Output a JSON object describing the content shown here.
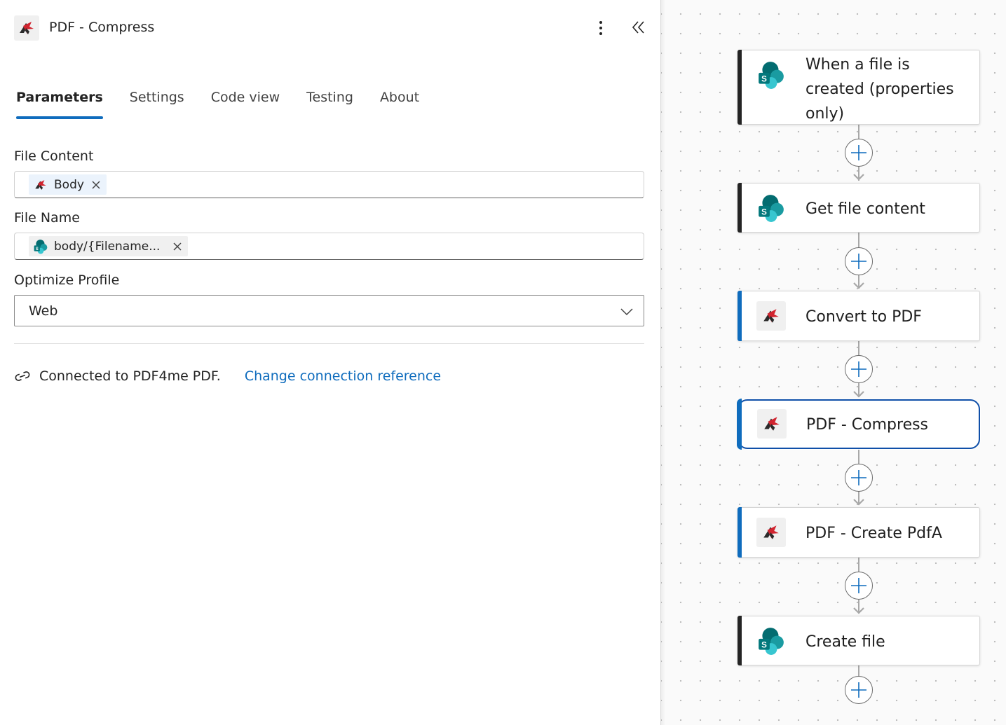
{
  "panel": {
    "title": "PDF - Compress",
    "tabs": [
      {
        "label": "Parameters",
        "active": true
      },
      {
        "label": "Settings",
        "active": false
      },
      {
        "label": "Code view",
        "active": false
      },
      {
        "label": "Testing",
        "active": false
      },
      {
        "label": "About",
        "active": false
      }
    ],
    "fields": {
      "file_content": {
        "label": "File Content",
        "token": "Body",
        "token_icon": "pdf4me-icon"
      },
      "file_name": {
        "label": "File Name",
        "token": "body/{Filename...",
        "token_icon": "sharepoint-icon"
      },
      "optimize_profile": {
        "label": "Optimize Profile",
        "value": "Web"
      }
    },
    "connection": {
      "text": "Connected to PDF4me PDF.",
      "link": "Change connection reference"
    }
  },
  "flow": {
    "nodes": [
      {
        "title": "When a file is created (properties only)",
        "icon": "sharepoint-icon"
      },
      {
        "title": "Get file content",
        "icon": "sharepoint-icon"
      },
      {
        "title": "Convert to PDF",
        "icon": "pdf4me-icon"
      },
      {
        "title": "PDF - Compress",
        "icon": "pdf4me-icon",
        "selected": true
      },
      {
        "title": "PDF - Create PdfA",
        "icon": "pdf4me-icon"
      },
      {
        "title": "Create file",
        "icon": "sharepoint-icon"
      }
    ]
  },
  "colors": {
    "accent_blue": "#0f6cbd",
    "sharepoint_accent": "#242424",
    "selected_border": "#0f4fa8"
  }
}
